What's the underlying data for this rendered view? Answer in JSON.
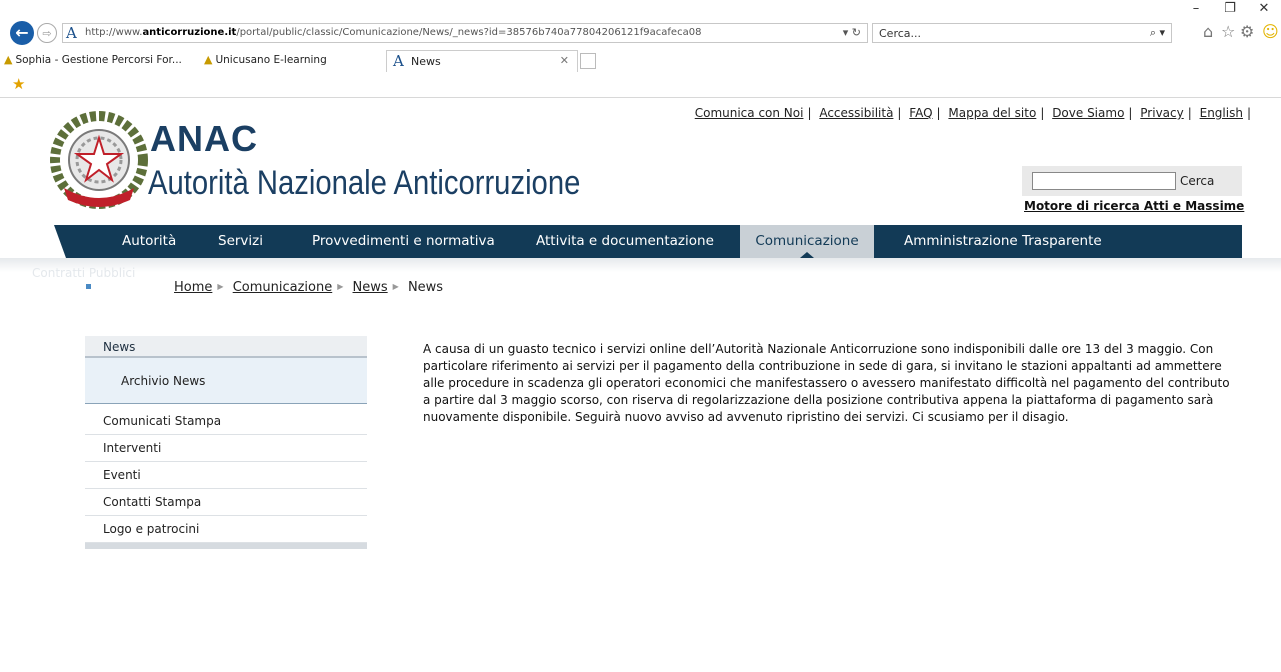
{
  "browser": {
    "url_prefix": "http://www.",
    "url_domain": "anticorruzione.it",
    "url_rest": "/portal/public/classic/Comunicazione/News/_news?id=38576b740a77804206121f9acafeca08",
    "search_placeholder": "Cerca...",
    "favorites": [
      "Sophia - Gestione Percorsi For...",
      "Unicusano E-learning"
    ],
    "active_tab": "News"
  },
  "header": {
    "title": "ANAC",
    "subtitle": "Autorità Nazionale Anticorruzione",
    "emblem_ribbon": "REPUBBLICA ITALIANA",
    "links": [
      "Comunica con Noi",
      "Accessibilità",
      "FAQ",
      "Mappa del sito",
      "Dove Siamo",
      "Privacy",
      "English"
    ],
    "search_button": "Cerca",
    "search_caption": "Motore di ricerca Atti e Massime"
  },
  "nav": {
    "items": [
      "Autorità",
      "Servizi",
      "Provvedimenti e normativa",
      "Attivita e documentazione",
      "Comunicazione",
      "Amministrazione Trasparente"
    ],
    "active": "Comunicazione",
    "ghost_text": "Contratti Pubblici"
  },
  "breadcrumb": [
    "Home",
    "Comunicazione",
    "News",
    "News"
  ],
  "sidebar": {
    "header": "News",
    "sub_item": "Archivio News",
    "items": [
      "Comunicati Stampa",
      "Interventi",
      "Eventi",
      "Contatti Stampa",
      "Logo e patrocini"
    ]
  },
  "article": {
    "body": "A causa di un guasto tecnico i servizi online dell’Autorità Nazionale Anticorruzione sono indisponibili dalle ore 13 del 3 maggio. Con particolare riferimento ai servizi per il pagamento della contribuzione in sede di gara, si invitano le stazioni appaltanti ad ammettere alle procedure in scadenza gli operatori economici che manifestassero o avessero manifestato difficoltà nel pagamento del contributo a partire dal 3 maggio scorso, con riserva di regolarizzazione della posizione contributiva appena la piattaforma di pagamento sarà nuovamente disponibile. Seguirà nuovo avviso ad avvenuto ripristino dei servizi. Ci scusiamo per il disagio."
  },
  "colors": {
    "nav_bg": "#123a56",
    "nav_active_bg": "#c9d0d6",
    "brand_text": "#1b3f63"
  }
}
